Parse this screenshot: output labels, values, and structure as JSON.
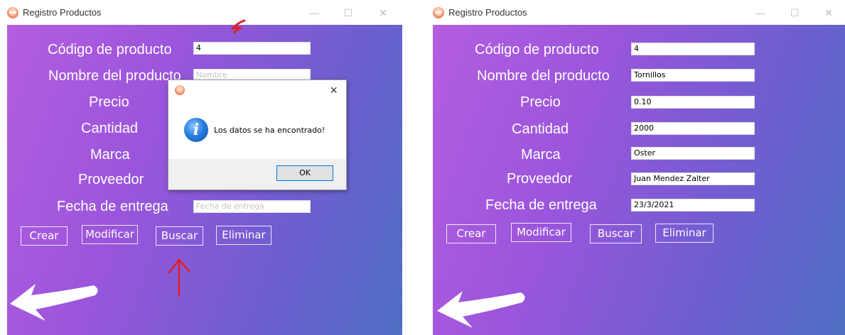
{
  "colors": {
    "gradient_start": "#b45ee0",
    "gradient_end": "#4f6fc4",
    "annotation_red": "#e02020"
  },
  "left_window": {
    "title": "Registro Productos",
    "labels": {
      "codigo": "Código de producto",
      "nombre": "Nombre del producto",
      "precio": "Precio",
      "cantidad": "Cantidad",
      "marca": "Marca",
      "proveedor": "Proveedor",
      "fecha": "Fecha  de entrega"
    },
    "fields": {
      "codigo_value": "4",
      "nombre_placeholder": "Nombre",
      "fecha_placeholder": "Fecha de entrega"
    },
    "buttons": {
      "crear": "Crear",
      "modificar": "Modificar",
      "buscar": "Buscar",
      "eliminar": "Eliminar"
    },
    "dialog": {
      "close": "×",
      "message": "Los datos se ha encontrado!",
      "ok": "OK"
    }
  },
  "right_window": {
    "title": "Registro Productos",
    "labels": {
      "codigo": "Código de producto",
      "nombre": "Nombre del producto",
      "precio": "Precio",
      "cantidad": "Cantidad",
      "marca": "Marca",
      "proveedor": "Proveedor",
      "fecha": "Fecha  de entrega"
    },
    "fields": {
      "codigo_value": "4",
      "nombre_value": "Tornillos",
      "precio_value": "0.10",
      "cantidad_value": "2000",
      "marca_value": "Oster",
      "proveedor_value": "Juan Mendez Zalter",
      "fecha_value": "23/3/2021"
    },
    "buttons": {
      "crear": "Crear",
      "modificar": "Modificar",
      "buscar": "Buscar",
      "eliminar": "Eliminar"
    }
  },
  "window_controls": {
    "minimize": "—",
    "maximize": "☐",
    "close": "✕"
  }
}
